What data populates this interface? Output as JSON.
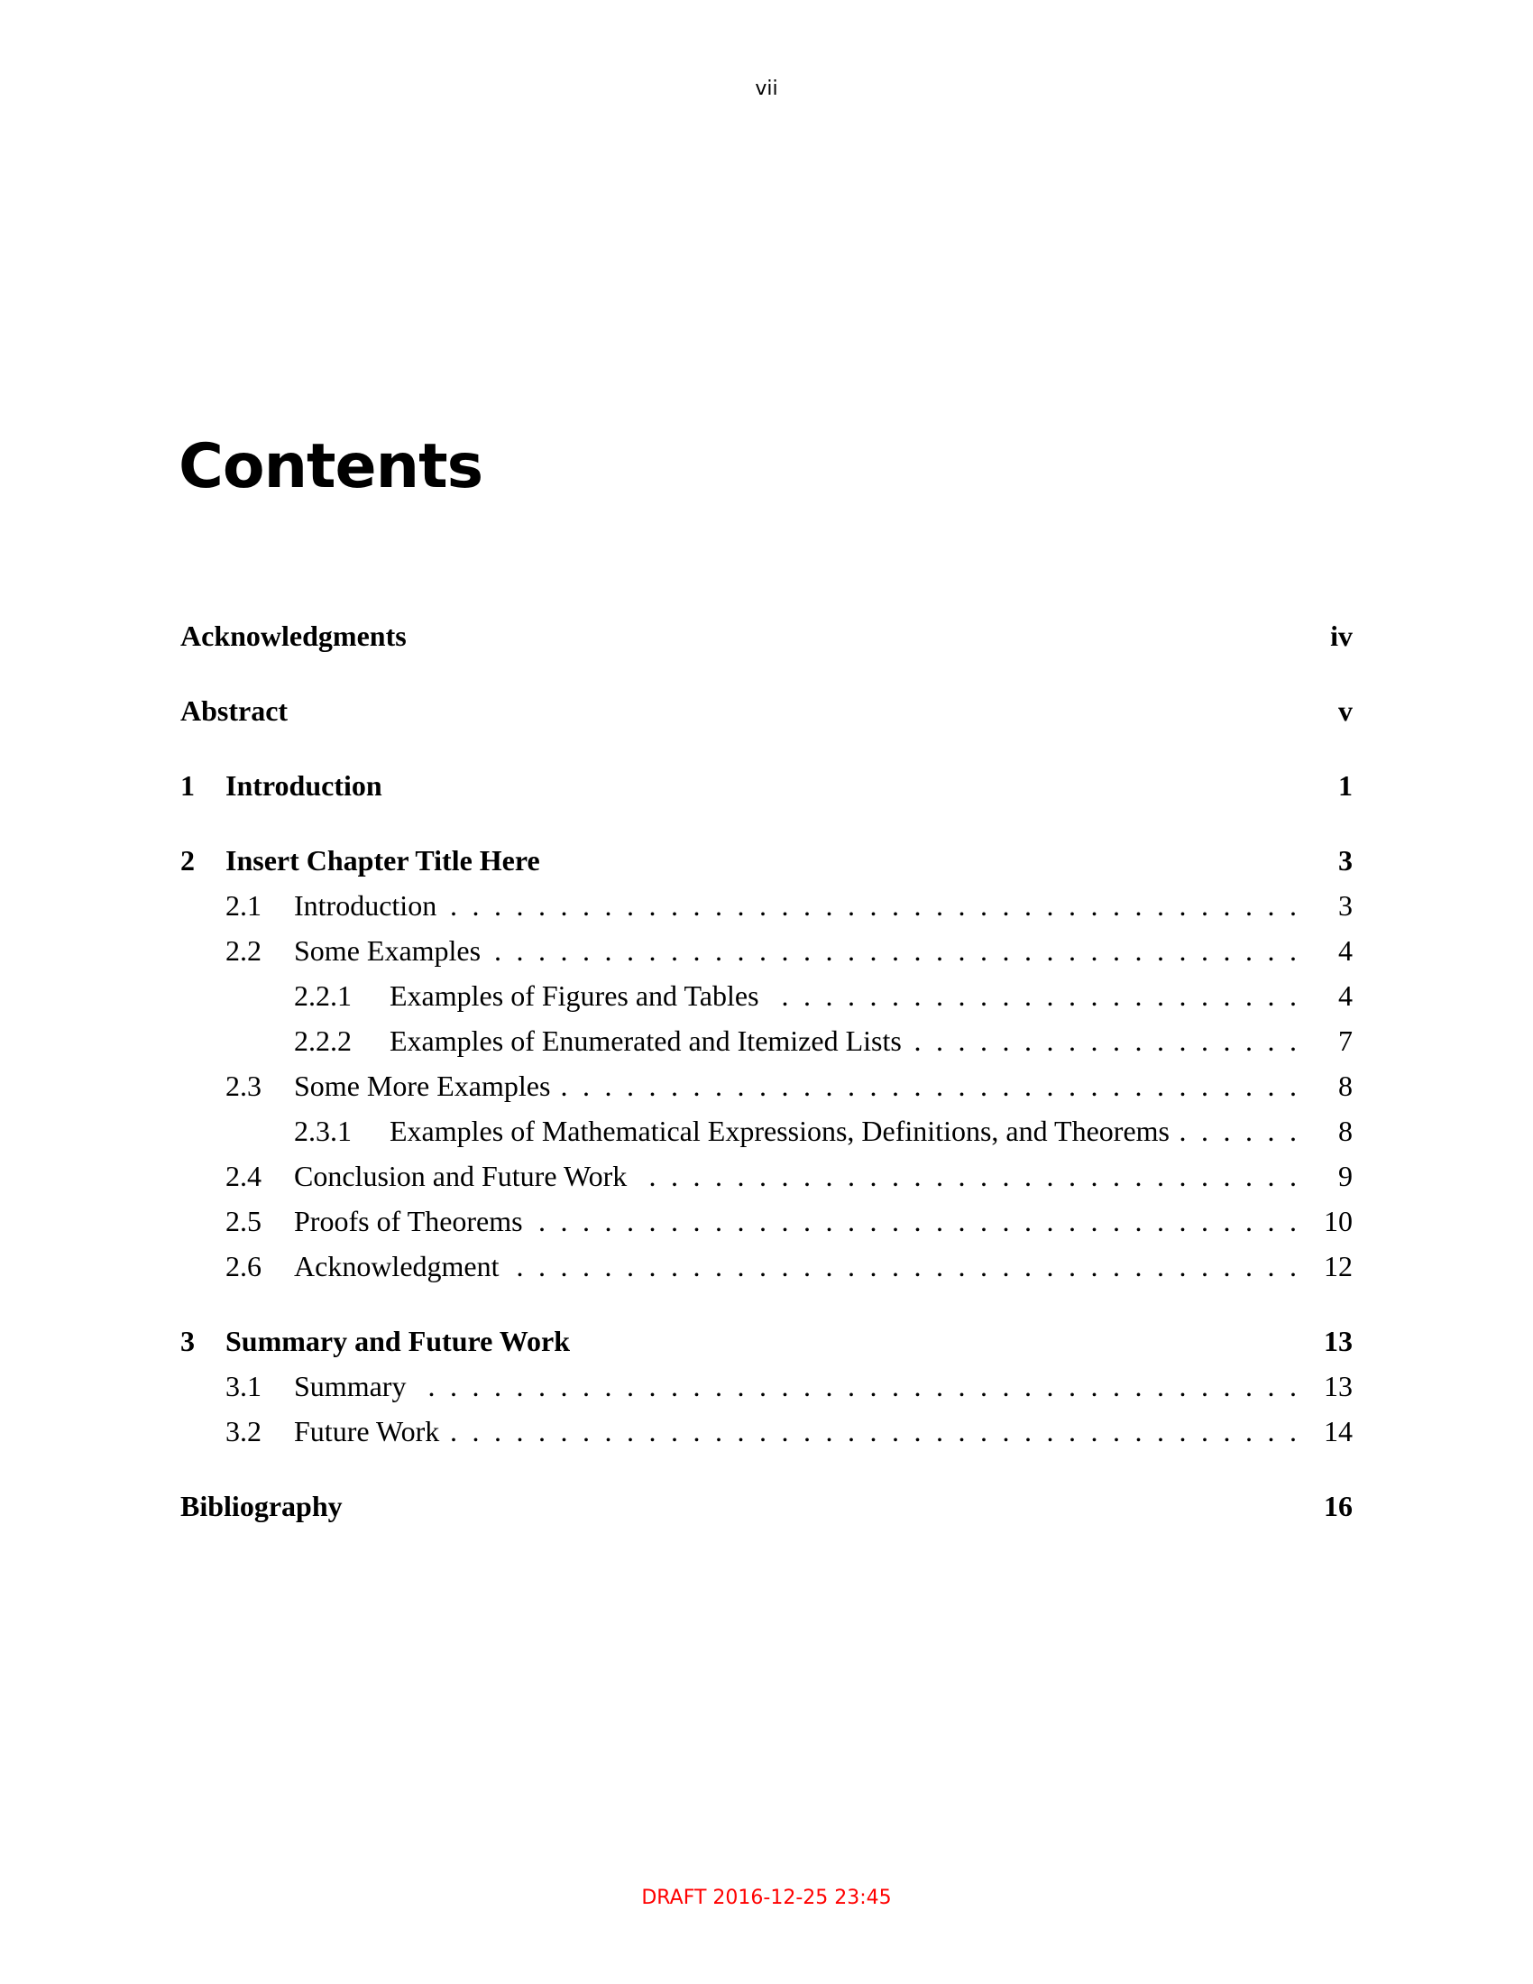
{
  "header": {
    "page_number": "vii"
  },
  "title": "Contents",
  "toc": [
    {
      "level": 0,
      "num": "",
      "text": "Acknowledgments",
      "page": "iv",
      "gap": false
    },
    {
      "level": 0,
      "num": "",
      "text": "Abstract",
      "page": "v",
      "gap": true
    },
    {
      "level": 0,
      "num": "1",
      "text": "Introduction",
      "page": "1",
      "gap": true
    },
    {
      "level": 0,
      "num": "2",
      "text": "Insert Chapter Title Here",
      "page": "3",
      "gap": true
    },
    {
      "level": 1,
      "num": "2.1",
      "text": "Introduction",
      "page": "3"
    },
    {
      "level": 1,
      "num": "2.2",
      "text": "Some Examples",
      "page": "4"
    },
    {
      "level": 2,
      "num": "2.2.1",
      "text": "Examples of Figures and Tables",
      "page": "4"
    },
    {
      "level": 2,
      "num": "2.2.2",
      "text": "Examples of Enumerated and Itemized Lists",
      "page": "7"
    },
    {
      "level": 1,
      "num": "2.3",
      "text": "Some More Examples",
      "page": "8"
    },
    {
      "level": 2,
      "num": "2.3.1",
      "text": "Examples of Mathematical Expressions, Definitions, and Theorems",
      "page": "8"
    },
    {
      "level": 1,
      "num": "2.4",
      "text": "Conclusion and Future Work",
      "page": "9"
    },
    {
      "level": 1,
      "num": "2.5",
      "text": "Proofs of Theorems",
      "page": "10"
    },
    {
      "level": 1,
      "num": "2.6",
      "text": "Acknowledgment",
      "page": "12"
    },
    {
      "level": 0,
      "num": "3",
      "text": "Summary and Future Work",
      "page": "13",
      "gap": true
    },
    {
      "level": 1,
      "num": "3.1",
      "text": "Summary",
      "page": "13"
    },
    {
      "level": 1,
      "num": "3.2",
      "text": "Future Work",
      "page": "14"
    },
    {
      "level": 0,
      "num": "",
      "text": "Bibliography",
      "page": "16",
      "gap": true
    }
  ],
  "footer": {
    "draft_stamp": "DRAFT 2016-12-25 23:45",
    "draft_color": "#ff0000"
  }
}
